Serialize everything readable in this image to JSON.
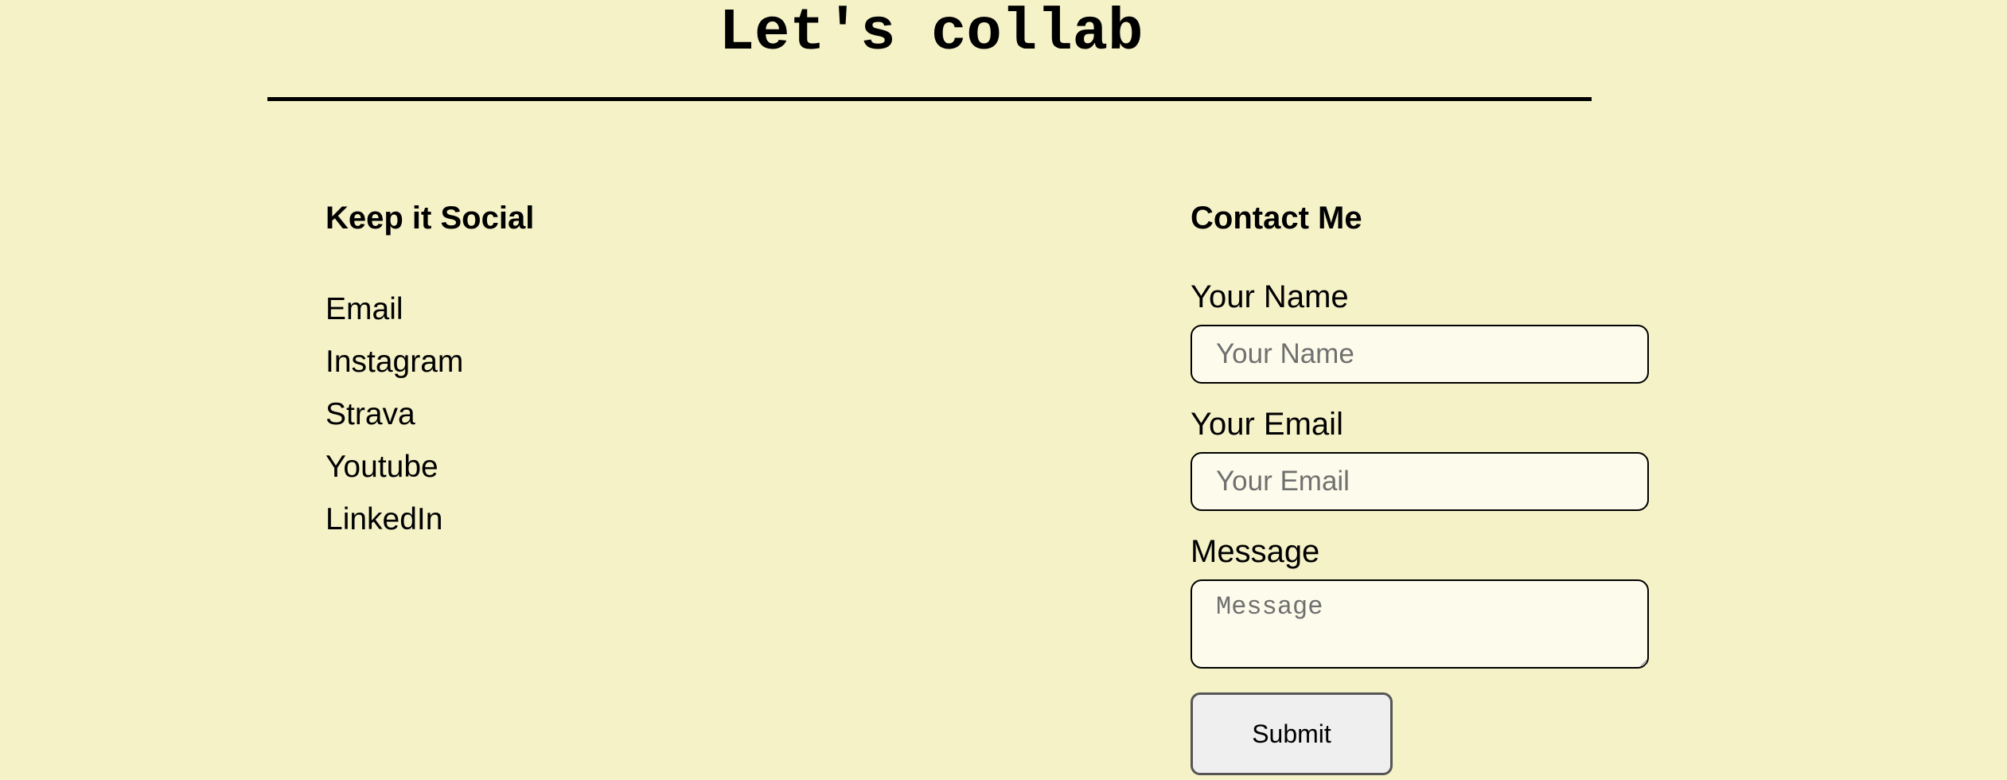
{
  "page": {
    "title": "Let's collab"
  },
  "social": {
    "heading": "Keep it Social",
    "links": [
      {
        "label": "Email"
      },
      {
        "label": "Instagram"
      },
      {
        "label": "Strava"
      },
      {
        "label": "Youtube"
      },
      {
        "label": "LinkedIn"
      }
    ]
  },
  "contact": {
    "heading": "Contact Me",
    "name_label": "Your Name",
    "name_placeholder": "Your Name",
    "name_value": "",
    "email_label": "Your Email",
    "email_placeholder": "Your Email",
    "email_value": "",
    "message_label": "Message",
    "message_placeholder": "Message",
    "message_value": "",
    "submit_label": "Submit"
  },
  "colors": {
    "background": "#f5f2c8",
    "input_background": "#fdfcec",
    "text": "#000000",
    "button_background": "#efefef"
  }
}
